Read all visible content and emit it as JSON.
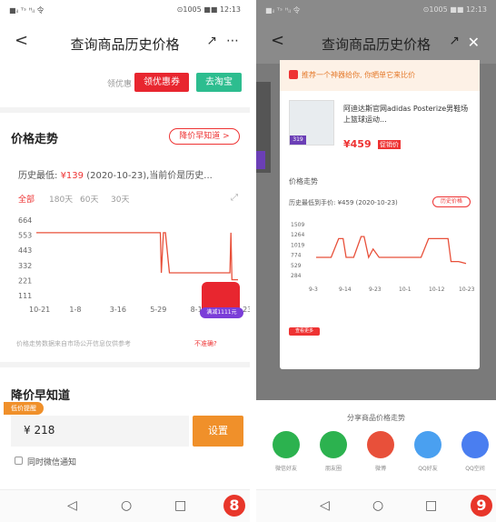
{
  "colors": {
    "accent_red": "#e33",
    "orange": "#f0902a",
    "green": "#2dbd8f",
    "line": "#e8503a"
  },
  "left": {
    "status": {
      "left": "■ᵢₗ ᵀˢ ᴴᵢₗ 令",
      "right": "⊙1005 ■■ 12:13"
    },
    "title": "查询商品历史价格",
    "back": "<",
    "share": "↗",
    "more": "⋯",
    "coupon_small": "领优惠",
    "btn_coupon": "领优惠券",
    "btn_taobao": "去淘宝",
    "section_trend": "价格走势",
    "price_alert_pill": "降价早知道 >",
    "history_text_pre": "历史最低: ",
    "history_low": "¥139",
    "history_text_post": " (2020-10-23),当前价是历史...",
    "tabs": [
      "全部",
      "180天",
      "60天",
      "30天"
    ],
    "chart_data": {
      "type": "line",
      "yticks": [
        "664",
        "553",
        "443",
        "332",
        "221",
        "111"
      ],
      "xticks": [
        "10-21",
        "1-8",
        "3-16",
        "5-29",
        "8-10",
        "10-23"
      ],
      "ylim": [
        0,
        664
      ],
      "x": [
        0,
        0.1,
        0.2,
        0.3,
        0.4,
        0.5,
        0.6,
        0.615,
        0.62,
        0.63,
        0.64,
        0.66,
        0.7,
        0.8,
        0.9,
        0.96,
        0.965,
        0.97,
        1.0
      ],
      "y": [
        553,
        553,
        553,
        553,
        553,
        553,
        553,
        553,
        200,
        553,
        553,
        200,
        200,
        200,
        200,
        200,
        553,
        139,
        139
      ]
    },
    "sale_badge": "满减1111元",
    "footer_note": "价格走势数据来自市场公开信息仅供参考",
    "footer_link": "不准确?",
    "section_alert": "降价早知道",
    "alert_tag": "低价提醒",
    "price": "¥  218",
    "btn_remind": "设置",
    "checkbox_label": "同时微信通知",
    "nav": [
      "◁",
      "○",
      "□"
    ],
    "badge": "8"
  },
  "right": {
    "status": {
      "left": "■ᵢₗ ᵀˢ ᴴᵢₗ 令",
      "right": "⊙1005 ■■ 12:13"
    },
    "title": "查询商品历史价格",
    "back": "<",
    "share": "↗",
    "close": "✕",
    "banner": "推荐一个神器给你, 你晒单它来比价",
    "product_title": "阿迪达斯官网adidas Posterize男鞋场上篮球运动...",
    "price": "¥459",
    "promo_tag": "促销价",
    "img_tag": "319",
    "section": "价格走势",
    "history_line": "历史最低到手价: ¥459 (2020-10-23)",
    "history_btn": "历史价格",
    "chart_data": {
      "type": "line",
      "yticks": [
        "1509",
        "1264",
        "1019",
        "774",
        "529",
        "284"
      ],
      "xticks": [
        "9-3",
        "9-14",
        "9-23",
        "10-1",
        "10-12",
        "10-23"
      ],
      "ylim": [
        284,
        1509
      ],
      "x": [
        0,
        0.1,
        0.15,
        0.18,
        0.2,
        0.25,
        0.3,
        0.32,
        0.35,
        0.38,
        0.42,
        0.5,
        0.6,
        0.7,
        0.75,
        0.8,
        0.88,
        0.9,
        0.95,
        1.0
      ],
      "y": [
        700,
        700,
        1150,
        1150,
        700,
        700,
        1200,
        1200,
        700,
        900,
        700,
        700,
        700,
        700,
        1150,
        1150,
        1150,
        600,
        600,
        550
      ]
    },
    "red_tag": "查看更多",
    "share_title": "分享商品价格走势",
    "share_items": [
      "微信好友",
      "朋友圈",
      "微博",
      "QQ好友",
      "QQ空间"
    ],
    "nav": [
      "◁",
      "○",
      "□"
    ],
    "badge": "9"
  }
}
